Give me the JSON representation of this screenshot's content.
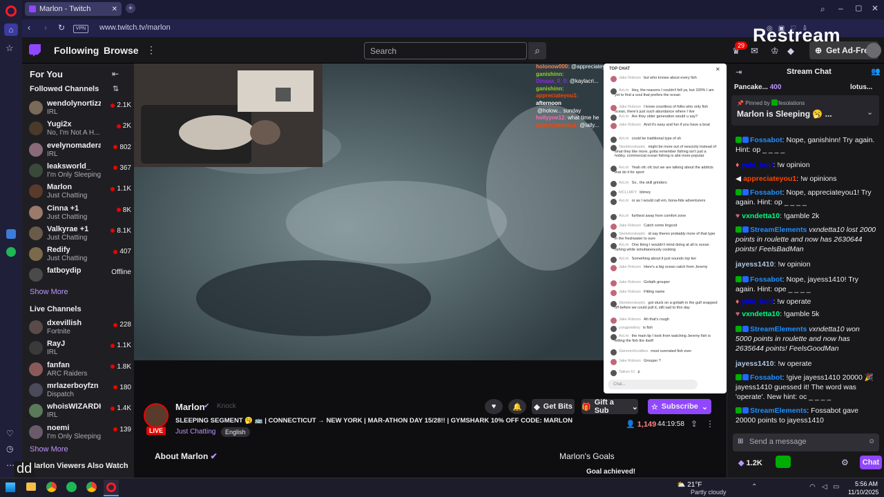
{
  "browser": {
    "tab_title": "Marlon - Twitch",
    "url": "www.twitch.tv/marlon",
    "vpn_label": "VPN"
  },
  "twitch_nav": {
    "following": "Following",
    "browse": "Browse",
    "search_placeholder": "Search",
    "notif_count": "29",
    "ad_free": "Get Ad-Free"
  },
  "restream_logo": "Restream",
  "sidebar": {
    "for_you": "For You",
    "followed_header": "Followed Channels",
    "followed": [
      {
        "name": "wendolynortizz",
        "sub": "IRL",
        "viewers": "2.1K",
        "color": "#7a6a5a"
      },
      {
        "name": "Yugi2x",
        "sub": "No, I'm Not A H...",
        "viewers": "2K",
        "color": "#4a3a2a"
      },
      {
        "name": "evelynomadera",
        "sub": "IRL",
        "viewers": "802",
        "color": "#8a6a7a"
      },
      {
        "name": "leaksworld_",
        "sub": "I'm Only Sleeping",
        "viewers": "367",
        "color": "#3a4a3a"
      },
      {
        "name": "Marlon",
        "sub": "Just Chatting",
        "viewers": "1.1K",
        "color": "#5a3a2a"
      },
      {
        "name": "Cinna +1",
        "sub": "Just Chatting",
        "viewers": "8K",
        "color": "#9a7a6a"
      },
      {
        "name": "Valkyrae +1",
        "sub": "Just Chatting",
        "viewers": "8.1K",
        "color": "#6a5a4a"
      },
      {
        "name": "Redify",
        "sub": "Just Chatting",
        "viewers": "407",
        "color": "#7a6a4a"
      },
      {
        "name": "fatboydip",
        "sub": "",
        "viewers": "Offline",
        "color": "#4a4a4a"
      }
    ],
    "show_more_1": "Show More",
    "live_header": "Live Channels",
    "live": [
      {
        "name": "dxevillish",
        "sub": "Fortnite",
        "viewers": "228",
        "color": "#5a4a4a"
      },
      {
        "name": "RayJ",
        "sub": "IRL",
        "viewers": "1.1K",
        "color": "#3a3a3a"
      },
      {
        "name": "fanfan",
        "sub": "ARC Raiders",
        "viewers": "1.8K",
        "color": "#8a5a5a"
      },
      {
        "name": "mrlazerboyfzn",
        "sub": "Dispatch",
        "viewers": "180",
        "color": "#4a4a5a"
      },
      {
        "name": "whoisWIZARDK...",
        "sub": "IRL",
        "viewers": "1.4K",
        "color": "#5a7a5a"
      },
      {
        "name": "noemi",
        "sub": "I'm Only Sleeping",
        "viewers": "139",
        "color": "#6a5a6a"
      }
    ],
    "show_more_2": "Show More",
    "also_watch": "Marlon Viewers Also Watch",
    "cc": "dd"
  },
  "overlay_chat": [
    {
      "user": "holonow000:",
      "text": "@appreciatey...",
      "color": "#ff7f50"
    },
    {
      "user": "ganishinn:",
      "text": "",
      "color": "#9acd32"
    },
    {
      "user": "Dinaaa_0_0:",
      "text": "@kaylacri...",
      "color": "#8a2be2"
    },
    {
      "user": "ganishinn:",
      "text": "",
      "color": "#9acd32"
    },
    {
      "user": "appreciateyou1:",
      "text": "",
      "color": "#ff4500"
    },
    {
      "user": "afternoon",
      "text": "",
      "color": "#ffffff"
    },
    {
      "user": "",
      "text": "@holow... sunday",
      "color": "#ffffff"
    },
    {
      "user": "hollyyne12:",
      "text": "what time he",
      "color": "#ff69b4"
    },
    {
      "user": "appreciateyou1:",
      "text": "@lally...",
      "color": "#ff4500"
    }
  ],
  "embedded_chat": {
    "header": "TOP CHAT",
    "input": "Chat...",
    "lines": [
      {
        "u": "Jake Robson",
        "t": "but who knows about every fish"
      },
      {
        "u": "AxLrtr",
        "t": "Hey, the reasons I couldn't fell ya, but 100% I am yet to find a soul that prefers the ocean"
      },
      {
        "u": "Jake Robson",
        "t": "I know countless of folks who only fish ocean, there's just such abundance where I live"
      },
      {
        "u": "AxLrtr",
        "t": "Are they older generation would u say?"
      },
      {
        "u": "Jake Robson",
        "t": "And it's easy and fun if you have a boat"
      },
      {
        "u": "AxLrtr",
        "t": "could be traditional type of sh"
      },
      {
        "u": "Skeletonskeptic",
        "t": "might be more out of nescicity instead of what they like more, gotta remember fishing isn't just a hobby, commercial ocean fishing is alot more popular"
      },
      {
        "u": "AxLrtr",
        "t": "Yeah ofc ofc but we are talking about the addicts that do it for sport"
      },
      {
        "u": "AxLrtr",
        "t": "So.. the skill grinders"
      },
      {
        "u": "MCLLMFY",
        "t": "blimey"
      },
      {
        "u": "AxLrtr",
        "t": "or as I would call em, bona-fide adventurers"
      },
      {
        "u": "AxLrtr",
        "t": "furthest away from comfort zone"
      },
      {
        "u": "Jake Robson",
        "t": "Catch some lingcod"
      },
      {
        "u": "Skeletonskeptic",
        "t": "id say thereo probably more of that type in the freshwater to sure"
      },
      {
        "u": "AxLrtr",
        "t": "One thing I wouldn't mind doing at all is ocean fishing while simultaneously cooking"
      },
      {
        "u": "AxLrtr",
        "t": "Something about it just sounds top tier"
      },
      {
        "u": "Jake Robson",
        "t": "Here's a big ocean catch from Jeremy"
      },
      {
        "u": "Jake Robson",
        "t": "Goliath grouper"
      },
      {
        "u": "Jake Robson",
        "t": "Fitting name"
      },
      {
        "u": "Skeletonskeptic",
        "t": "got stuck on a goliath in the gulf snapped off before we could pull it, still sad to this day"
      },
      {
        "u": "Jake Robson",
        "t": "Ah that's rough"
      },
      {
        "u": "yungpowboy",
        "t": "is fish"
      },
      {
        "u": "AxLrtr",
        "t": "the main tip I took from watching Jeremy fish is letting the fish tire itself"
      },
      {
        "u": "Slammin5crafties",
        "t": "most overrated fish ever"
      },
      {
        "u": "Jake Robson",
        "t": "Grouper ?"
      },
      {
        "u": "Taikon 51",
        "t": "p"
      }
    ]
  },
  "stream_info": {
    "channel": "Marlon",
    "knock": "Knock",
    "title": "SLEEPING SEGMENT 🥱 🚌 | CONNECTICUT → NEW YORK | MAR-ATHON DAY 15/28!! | GYMSHARK 10% OFF CODE: MARLON",
    "category": "Just Chatting",
    "language": "English",
    "live": "LIVE",
    "viewers": "1,149",
    "uptime": "44:19:58",
    "get_bits": "Get Bits",
    "gift_sub": "Gift a Sub",
    "subscribe": "Subscribe",
    "about": "About Marlon",
    "goals": "Marlon's Goals",
    "goal_achieved": "Goal achieved!"
  },
  "stream_chat": {
    "header": "Stream Chat",
    "top1_name": "Pancake...",
    "top1_val": "400",
    "top2_name": "lotus...",
    "pinned_by": "Pinned by",
    "pinned_user": "fesolations",
    "pinned_msg": "Marlon is Sleeping 🥱 ...",
    "send_placeholder": "Send a message",
    "points": "1.2K",
    "chat_btn": "Chat",
    "messages": [
      {
        "user": "Fossabot",
        "ucolor": "#1e90ff",
        "text": ": Nope, ganishinn! Try again. Hint: op _ _ _ _",
        "italic": false
      },
      {
        "user": "yuki_kuri",
        "ucolor": "#0000ff",
        "text": ": !w opinion",
        "italic": false
      },
      {
        "user": "appreciateyou1",
        "ucolor": "#ff4500",
        "text": ": !w opinions",
        "italic": false
      },
      {
        "user": "Fossabot",
        "ucolor": "#1e90ff",
        "text": ": Nope, appreciateyou1! Try again. Hint: op _ _ _ _",
        "italic": false
      },
      {
        "user": "vxndetta10",
        "ucolor": "#00ff7f",
        "text": ": !gamble 2k",
        "italic": false
      },
      {
        "user": "StreamElements",
        "ucolor": "#1e90ff",
        "text": " vxndetta10 lost 2000 points in roulette and now has 2630644 points! FeelsBadMan",
        "italic": true
      },
      {
        "user": "jayess1410",
        "ucolor": "#b0c4de",
        "text": ": !w opinion",
        "italic": false
      },
      {
        "user": "Fossabot",
        "ucolor": "#1e90ff",
        "text": ": Nope, jayess1410! Try again. Hint: ope _ _ _ _",
        "italic": false
      },
      {
        "user": "yuki_kuri",
        "ucolor": "#0000ff",
        "text": ": !w operate",
        "italic": false
      },
      {
        "user": "vxndetta10",
        "ucolor": "#00ff7f",
        "text": ": !gamble 5k",
        "italic": false
      },
      {
        "user": "StreamElements",
        "ucolor": "#1e90ff",
        "text": " vxndetta10 won 5000 points in roulette and now has 2635644 points! FeelsGoodMan",
        "italic": true
      },
      {
        "user": "jayess1410",
        "ucolor": "#b0c4de",
        "text": ": !w operate",
        "italic": false
      },
      {
        "user": "Fossabot",
        "ucolor": "#1e90ff",
        "text": ": !give jayess1410 20000 🎉 jayess1410 guessed it! The word was 'operate'. New hint: oc _ _ _ _",
        "italic": false
      },
      {
        "user": "StreamElements",
        "ucolor": "#1e90ff",
        "text": ": Fossabot gave 20000 points to jayess1410",
        "italic": false
      }
    ]
  },
  "taskbar": {
    "temp": "21°F",
    "weather": "Partly cloudy",
    "time": "5:56 AM",
    "date": "11/10/2025"
  },
  "colors": {
    "twitch_purple": "#9147ff",
    "live_red": "#eb0400",
    "link_purple": "#bf94ff"
  }
}
